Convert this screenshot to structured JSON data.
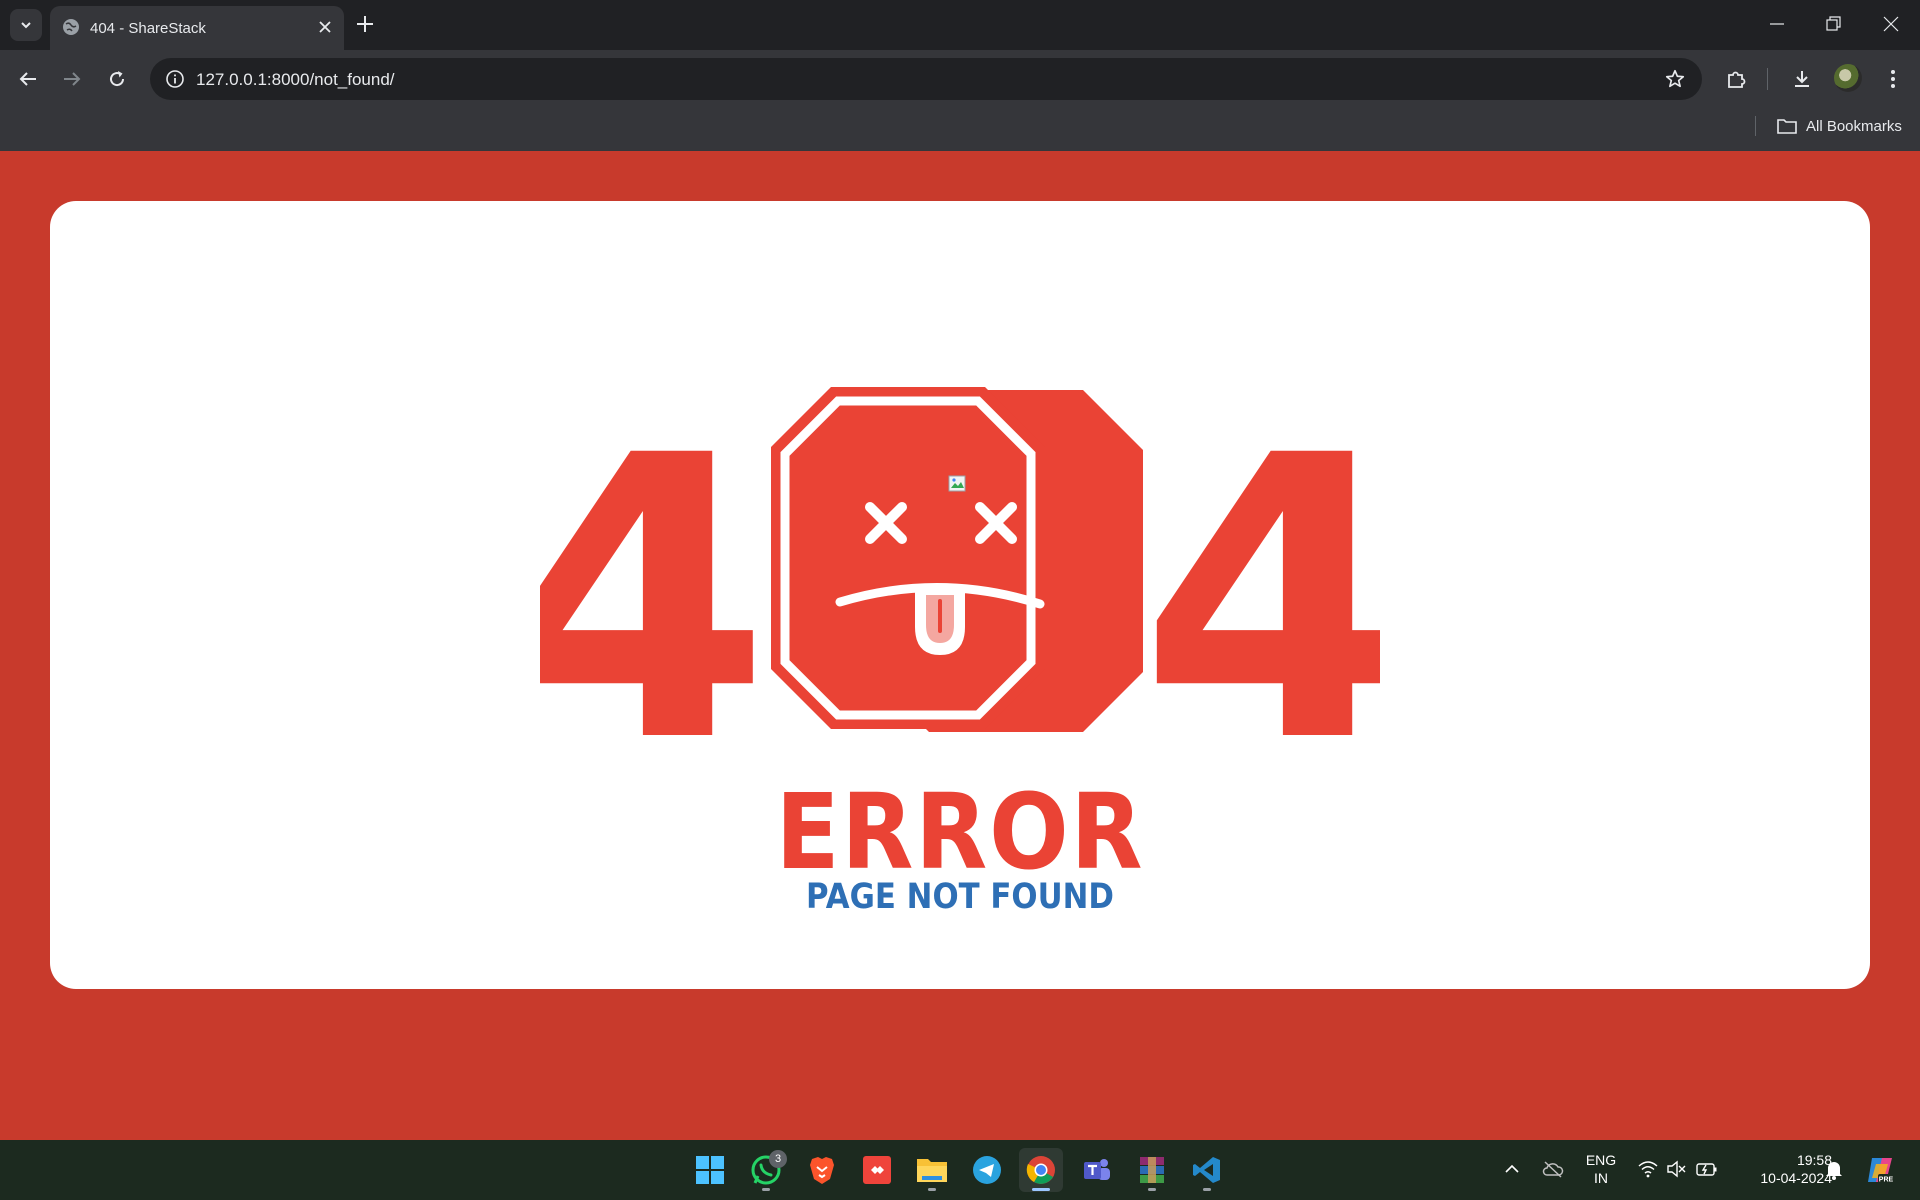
{
  "browser": {
    "tab_title": "404 - ShareStack",
    "url": "127.0.0.1:8000/not_found/",
    "bookmarks_label": "All Bookmarks"
  },
  "page": {
    "digit_left": "4",
    "digit_right": "4",
    "error_text": "ERROR",
    "subtitle": "PAGE NOT FOUND",
    "colors": {
      "background": "#c83a2c",
      "card": "#ffffff",
      "accent_red": "#ea4335",
      "subtitle_blue": "#2e6fb5"
    }
  },
  "taskbar": {
    "apps": [
      {
        "name": "windows-start",
        "icon": "windows-logo-icon"
      },
      {
        "name": "whatsapp",
        "icon": "whatsapp-icon",
        "badge": "3"
      },
      {
        "name": "brave",
        "icon": "brave-lion-icon"
      },
      {
        "name": "anydesk",
        "icon": "anydesk-icon"
      },
      {
        "name": "file-explorer",
        "icon": "folder-icon"
      },
      {
        "name": "telegram",
        "icon": "telegram-icon"
      },
      {
        "name": "chrome",
        "icon": "chrome-icon"
      },
      {
        "name": "teams",
        "icon": "teams-icon"
      },
      {
        "name": "winrar",
        "icon": "winrar-icon"
      },
      {
        "name": "vscode",
        "icon": "vscode-icon"
      }
    ],
    "language": "ENG",
    "region": "IN",
    "time": "19:58",
    "date": "10-04-2024"
  }
}
